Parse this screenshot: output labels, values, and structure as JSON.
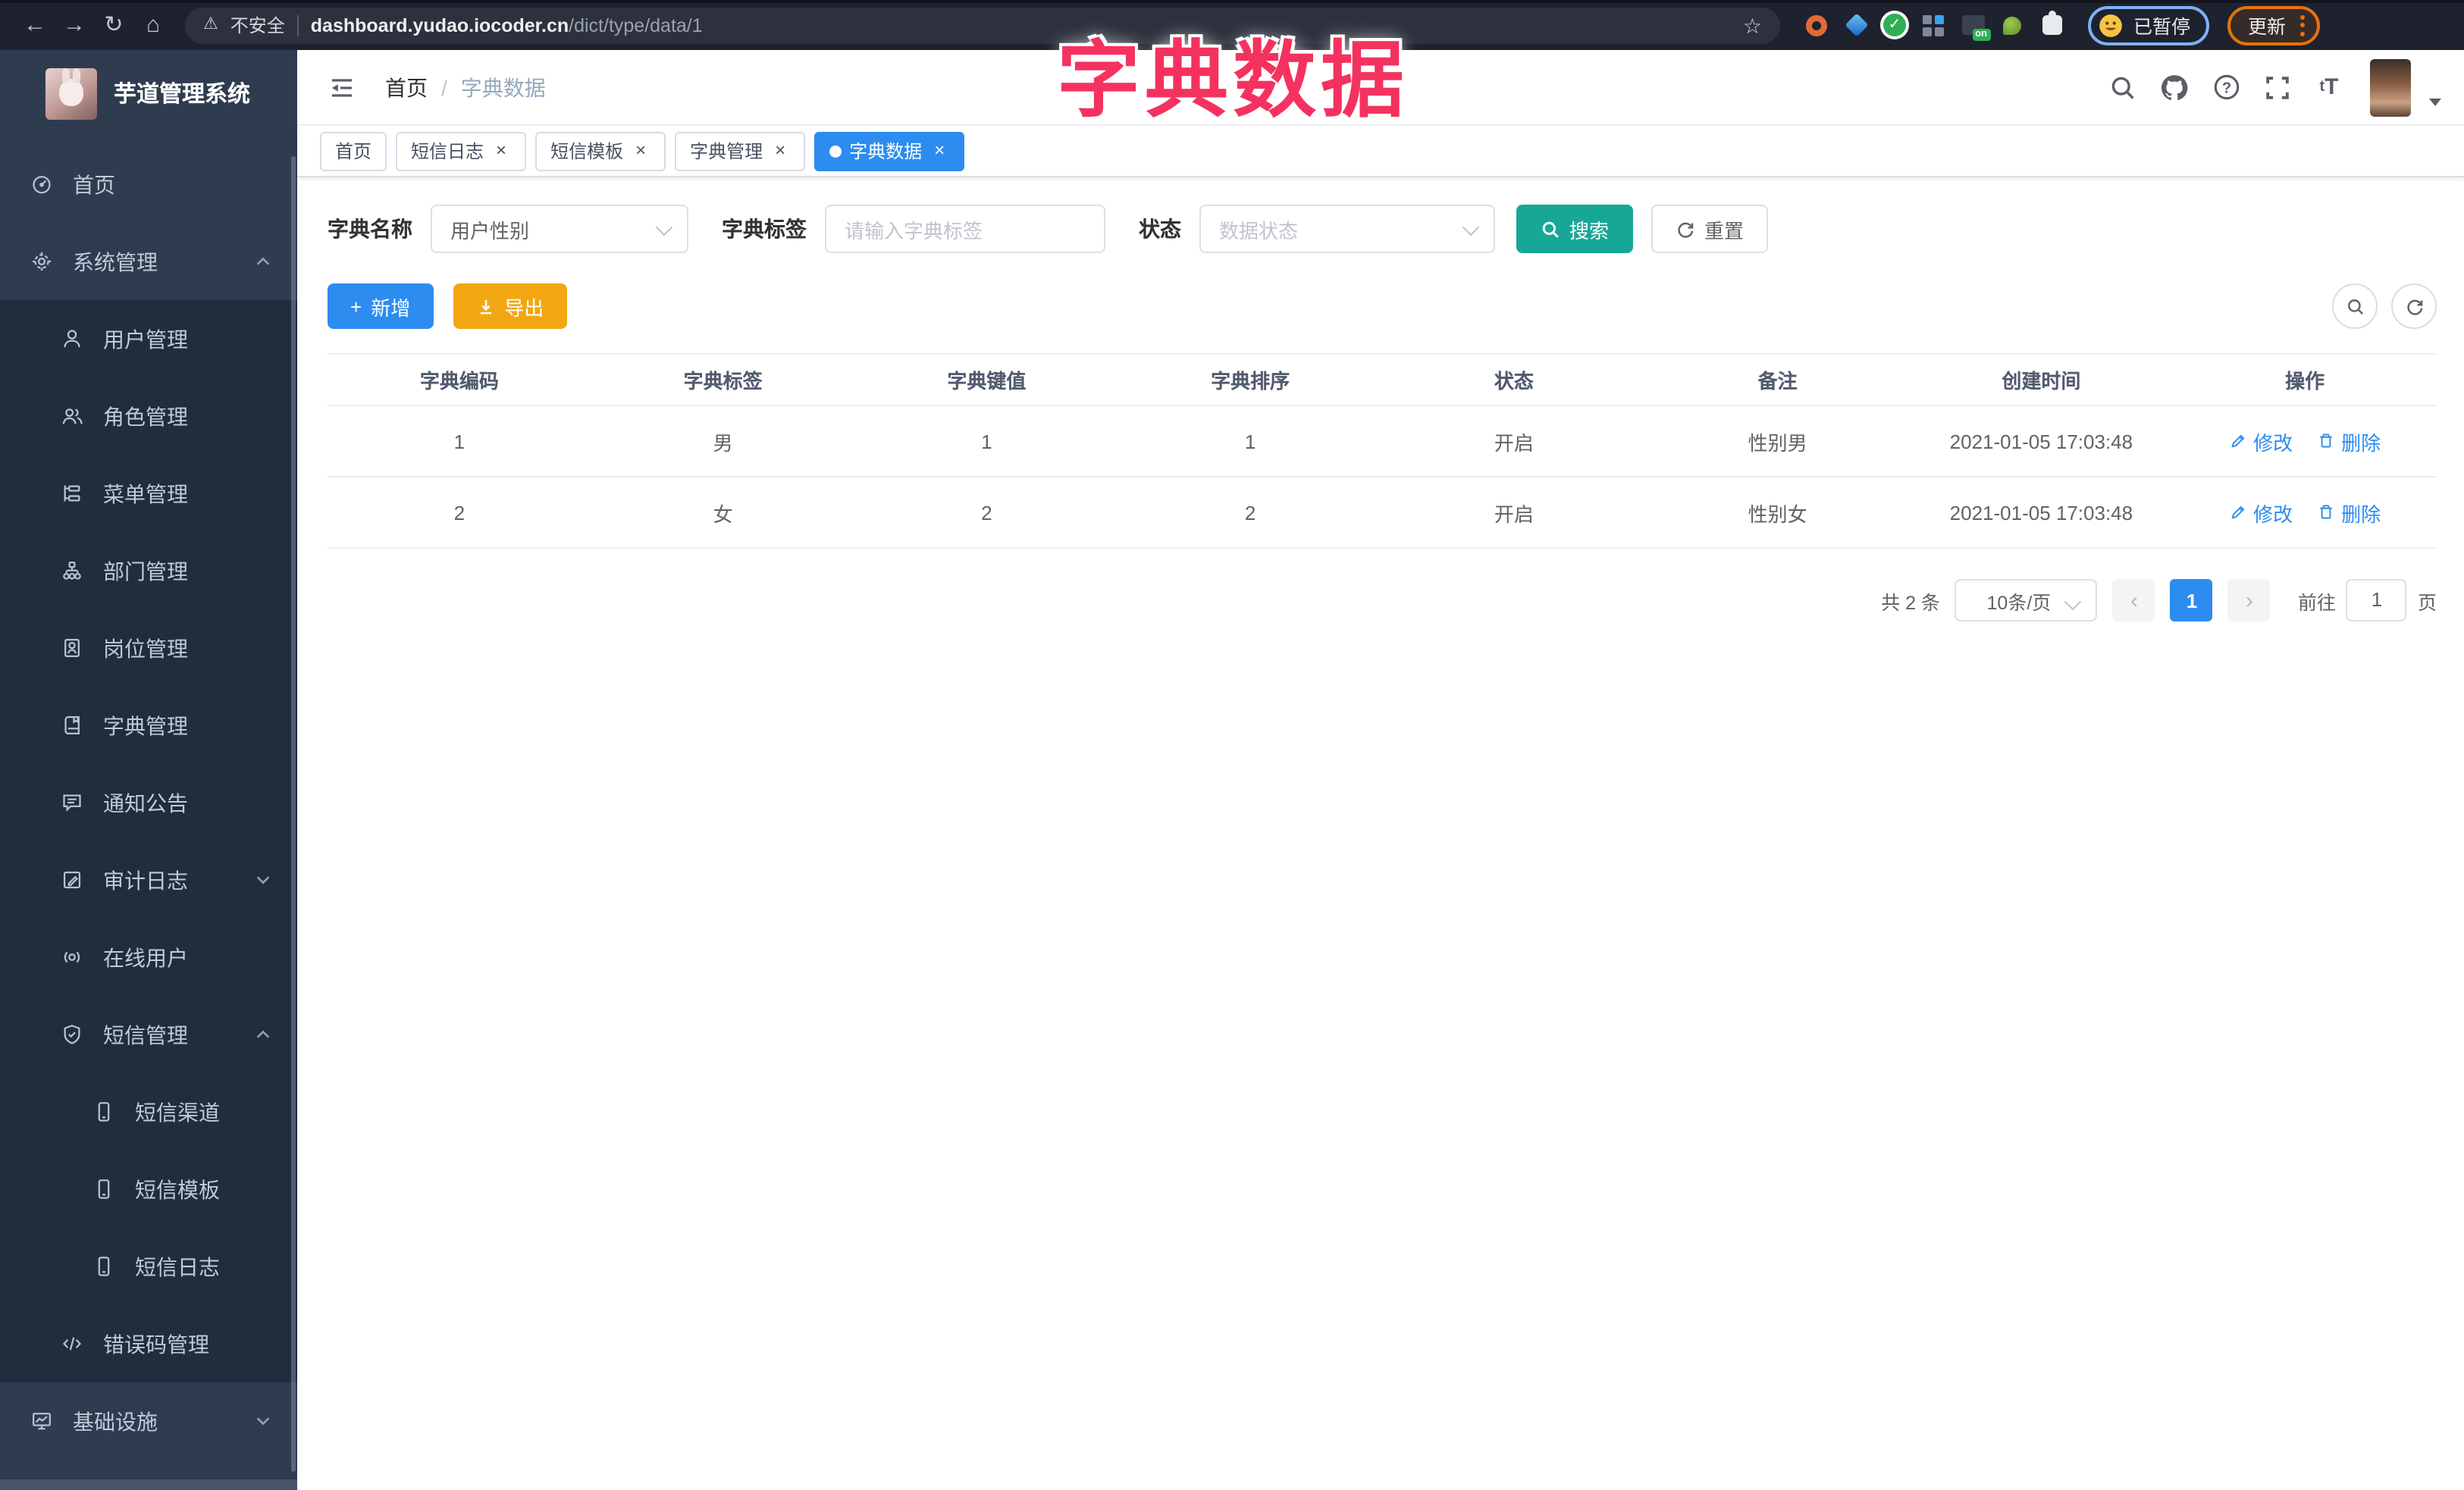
{
  "colors": {
    "primary": "#2d8cf0",
    "teal": "#17a797",
    "warning": "#f2a712",
    "sidebar_bg": "#2f3c50",
    "submenu_bg": "#1f2d3d",
    "overlay_pink": "#f4325f"
  },
  "browser": {
    "security_label": "不安全",
    "url_domain": "dashboard.yudao.iocoder.cn",
    "url_path": "/dict/type/data/1",
    "overlay_title": "字典数据",
    "paused_badge": "已暂停",
    "update_button": "更新",
    "nav_icons": [
      "back-icon",
      "forward-icon",
      "reload-icon",
      "home-icon"
    ],
    "extension_icons": [
      "bookmark-star-icon",
      "ext-orange-ring-icon",
      "ext-blue-gem-icon",
      "ext-green-check-icon",
      "ext-color-grid-icon",
      "ext-on-badge-icon",
      "ext-green-leaf-icon",
      "extensions-puzzle-icon"
    ]
  },
  "sidebar": {
    "app_title": "芋道管理系统",
    "items": [
      {
        "key": "home",
        "label": "首页",
        "icon": "dashboard-icon",
        "level": 1
      },
      {
        "key": "system",
        "label": "系统管理",
        "icon": "gear-icon",
        "level": 1,
        "arrow": "up"
      },
      {
        "key": "user",
        "label": "用户管理",
        "icon": "user-icon",
        "level": 2
      },
      {
        "key": "role",
        "label": "角色管理",
        "icon": "users-icon",
        "level": 2
      },
      {
        "key": "menu",
        "label": "菜单管理",
        "icon": "menu-tree-icon",
        "level": 2
      },
      {
        "key": "dept",
        "label": "部门管理",
        "icon": "org-icon",
        "level": 2
      },
      {
        "key": "post",
        "label": "岗位管理",
        "icon": "badge-icon",
        "level": 2
      },
      {
        "key": "dict",
        "label": "字典管理",
        "icon": "dict-book-icon",
        "level": 2
      },
      {
        "key": "notice",
        "label": "通知公告",
        "icon": "announcement-icon",
        "level": 2
      },
      {
        "key": "audit-log",
        "label": "审计日志",
        "icon": "audit-log-icon",
        "level": 2,
        "arrow": "down"
      },
      {
        "key": "online-user",
        "label": "在线用户",
        "icon": "online-user-icon",
        "level": 2
      },
      {
        "key": "sms",
        "label": "短信管理",
        "icon": "shield-check-icon",
        "level": 2,
        "arrow": "up"
      },
      {
        "key": "sms-channel",
        "label": "短信渠道",
        "icon": "phone-icon",
        "level": 3
      },
      {
        "key": "sms-template",
        "label": "短信模板",
        "icon": "phone-icon",
        "level": 3
      },
      {
        "key": "sms-log",
        "label": "短信日志",
        "icon": "phone-icon",
        "level": 3
      },
      {
        "key": "error-code",
        "label": "错误码管理",
        "icon": "code-icon",
        "level": 2
      },
      {
        "key": "infra",
        "label": "基础设施",
        "icon": "monitor-icon",
        "level": 1,
        "arrow": "down"
      }
    ]
  },
  "header": {
    "breadcrumb": [
      "首页",
      "字典数据"
    ],
    "breadcrumb_separator": "/",
    "icons": [
      "search-icon",
      "github-icon",
      "help-icon",
      "fullscreen-icon",
      "font-size-icon"
    ]
  },
  "tabs": [
    {
      "key": "home",
      "label": "首页",
      "closable": false,
      "active": false
    },
    {
      "key": "sms-log",
      "label": "短信日志",
      "closable": true,
      "active": false
    },
    {
      "key": "sms-template",
      "label": "短信模板",
      "closable": true,
      "active": false
    },
    {
      "key": "dict",
      "label": "字典管理",
      "closable": true,
      "active": false
    },
    {
      "key": "dict-data",
      "label": "字典数据",
      "closable": true,
      "active": true
    }
  ],
  "filters": {
    "name_label": "字典名称",
    "name_value": "用户性别",
    "tag_label": "字典标签",
    "tag_placeholder": "请输入字典标签",
    "status_label": "状态",
    "status_placeholder": "数据状态",
    "search_label": "搜索",
    "reset_label": "重置"
  },
  "toolbar": {
    "add_label": "新增",
    "export_label": "导出"
  },
  "table": {
    "columns": [
      "字典编码",
      "字典标签",
      "字典键值",
      "字典排序",
      "状态",
      "备注",
      "创建时间",
      "操作"
    ],
    "rows": [
      {
        "code": "1",
        "label": "男",
        "value": "1",
        "sort": "1",
        "status": "开启",
        "remark": "性别男",
        "created": "2021-01-05 17:03:48"
      },
      {
        "code": "2",
        "label": "女",
        "value": "2",
        "sort": "2",
        "status": "开启",
        "remark": "性别女",
        "created": "2021-01-05 17:03:48"
      }
    ],
    "edit_label": "修改",
    "delete_label": "删除"
  },
  "pagination": {
    "total_text": "共 2 条",
    "page_size": "10条/页",
    "current_page": "1",
    "goto_label": "前往",
    "goto_value": "1",
    "page_unit": "页"
  }
}
